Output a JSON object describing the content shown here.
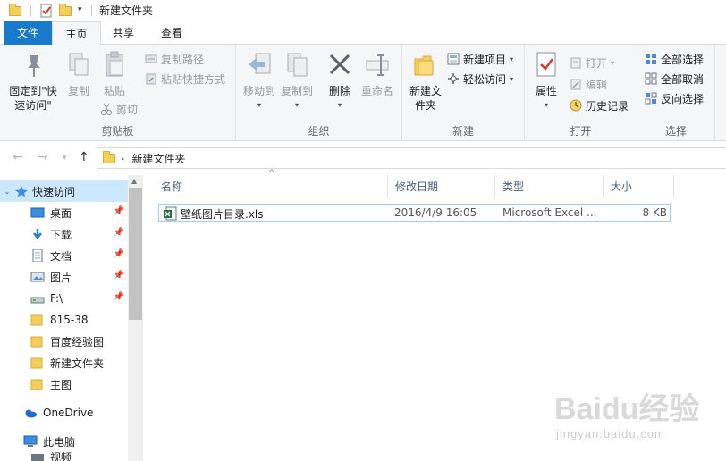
{
  "window": {
    "title": "新建文件夹"
  },
  "tabs": {
    "file": "文件",
    "home": "主页",
    "share": "共享",
    "view": "查看"
  },
  "ribbon": {
    "clipboard": {
      "label": "剪贴板",
      "pin_quick_access": "固定到\"快速访问\"",
      "copy": "复制",
      "paste": "粘贴",
      "copy_path": "复制路径",
      "paste_shortcut": "粘贴快捷方式",
      "cut": "剪切"
    },
    "organize": {
      "label": "组织",
      "move_to": "移动到",
      "copy_to": "复制到",
      "delete": "删除",
      "rename": "重命名"
    },
    "new": {
      "label": "新建",
      "new_folder": "新建文件夹",
      "new_item": "新建项目",
      "easy_access": "轻松访问"
    },
    "open": {
      "label": "打开",
      "properties": "属性",
      "open": "打开",
      "edit": "编辑",
      "history": "历史记录"
    },
    "select": {
      "label": "选择",
      "select_all": "全部选择",
      "select_none": "全部取消",
      "invert": "反向选择"
    }
  },
  "address": {
    "path": "新建文件夹"
  },
  "nav": {
    "quick_access": "快速访问",
    "items": [
      {
        "label": "桌面",
        "pinned": true
      },
      {
        "label": "下载",
        "pinned": true
      },
      {
        "label": "文档",
        "pinned": true
      },
      {
        "label": "图片",
        "pinned": true
      },
      {
        "label": "F:\\",
        "pinned": true
      },
      {
        "label": "815-38",
        "pinned": false
      },
      {
        "label": "百度经验图",
        "pinned": false
      },
      {
        "label": "新建文件夹",
        "pinned": false
      },
      {
        "label": "主图",
        "pinned": false
      }
    ],
    "onedrive": "OneDrive",
    "this_pc": "此电脑",
    "next_item": "视频"
  },
  "columns": {
    "name": "名称",
    "date": "修改日期",
    "type": "类型",
    "size": "大小"
  },
  "files": [
    {
      "name": "壁纸图片目录.xls",
      "date": "2016/4/9 16:05",
      "type": "Microsoft Excel ...",
      "size": "8 KB"
    }
  ],
  "watermark": {
    "logo": "Baidu经验",
    "sub": "jingyan.baidu.com"
  },
  "colors": {
    "accent": "#1979ca",
    "selection": "#cce8ff",
    "folder": "#f5cf5c"
  }
}
